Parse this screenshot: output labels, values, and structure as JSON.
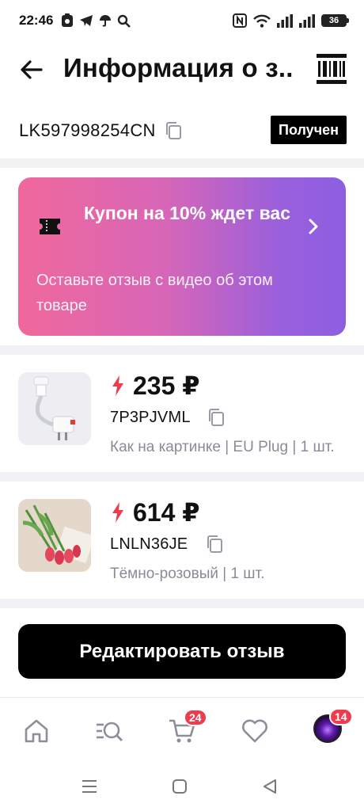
{
  "status_bar": {
    "time": "22:46",
    "battery": "36",
    "icons": [
      "app-icon",
      "telegram-icon",
      "umbrella-icon",
      "search-icon",
      "nfc-icon",
      "wifi-icon",
      "signal-icon",
      "signal-icon",
      "battery-icon"
    ]
  },
  "header": {
    "title": "Информация о з..."
  },
  "tracking": {
    "number": "LK597998254CN",
    "status": "Получен"
  },
  "coupon": {
    "title": "Купон на 10% ждет вас",
    "subtitle": "Оставьте отзыв с видео об этом товаре",
    "gradient_start": "#f0689b",
    "gradient_end": "#8c5fe0"
  },
  "products": [
    {
      "price": "235 ₽",
      "sku": "7P3PJVML",
      "variant": "Как на картинке | EU Plug | 1 шт."
    },
    {
      "price": "614 ₽",
      "sku": "LNLN36JE",
      "variant": "Тёмно-розовый | 1 шт."
    }
  ],
  "edit_button": {
    "label": "Редактировать отзыв"
  },
  "bottom_nav": {
    "items": [
      "home-icon",
      "catalog-search-icon",
      "cart-icon",
      "favorites-icon",
      "profile-avatar"
    ],
    "cart_badge": "24",
    "profile_badge": "14"
  },
  "colors": {
    "accent_red": "#ee3b4e",
    "badge_black": "#000000"
  }
}
